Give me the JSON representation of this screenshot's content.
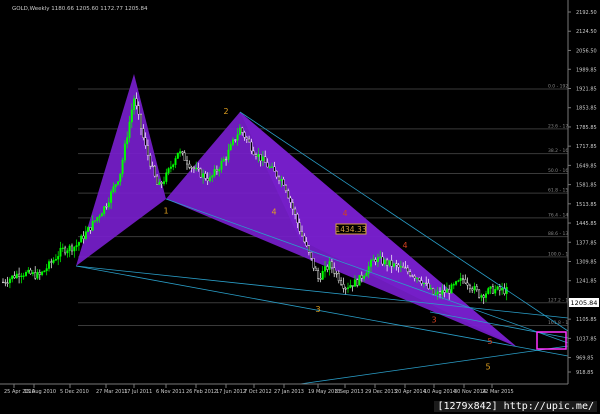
{
  "header": {
    "symbol_text": "GOLD,Weekly  1180.66 1205.60 1172.77 1205.84"
  },
  "chart_data": {
    "type": "candlestick",
    "instrument": "GOLD",
    "timeframe": "Weekly",
    "ohlc": [
      1180.66,
      1205.6,
      1172.77,
      1205.84
    ],
    "ylim": [
      916.0,
      2205.0
    ],
    "y_ticks": [
      "2192.50",
      "2124.50",
      "2056.50",
      "1989.85",
      "1921.85",
      "1853.85",
      "1785.85",
      "1717.85",
      "1649.85",
      "1581.85",
      "1513.85",
      "1445.85",
      "1377.85",
      "1309.85",
      "1241.85",
      "1173.85",
      "1105.85",
      "1037.85",
      "969.85",
      "918.85"
    ],
    "x_ticks": [
      "25 Apr 2010",
      "15 Aug 2010",
      "5 Dec 2010",
      "27 Mar 2011",
      "17 Jul 2011",
      "6 Nov 2011",
      "26 Feb 2012",
      "17 Jun 2012",
      "7 Oct 2012",
      "27 Jan 2013",
      "19 May 2013",
      "8 Sep 2013",
      "29 Dec 2013",
      "20 Apr 2014",
      "10 Aug 2014",
      "30 Nov 2014",
      "22 Mar 2015"
    ],
    "price_box": "1434.33",
    "current_price_tag": "1205.84",
    "fib_labels": [
      "0.0 - 1920.00",
      "23.6 - 1779.10",
      "38.2 - 1691.48",
      "50.0 - 1621.24",
      "61.8 - 1551.57",
      "76.4 - 1463.94",
      "88.6 - 1397.89",
      "100.0 - 1326.37",
      "127.2 - 1163.66",
      "161.8 - 1083.31"
    ],
    "pattern_points": [
      {
        "label": "2",
        "x": "17 Jun 2012",
        "y": 1790.0
      },
      {
        "label": "1",
        "x": "6 Nov 2011",
        "y": 1530.0
      },
      {
        "label": "4",
        "x": "27 Jan 2013",
        "y": 1440.0
      },
      {
        "label": "4",
        "x": "8 Sep 2013",
        "y": 1435.0
      },
      {
        "label": "4",
        "x": "20 Apr 2014",
        "y": 1330.0
      },
      {
        "label": "3",
        "x": "19 May 2013",
        "y": 1180.0
      },
      {
        "label": "3",
        "x": "10 Aug 2014",
        "y": 1130.0
      },
      {
        "label": "5",
        "x": "22 Mar 2015",
        "y": 1060.0
      },
      {
        "label": "5",
        "x": "22 Mar 2015",
        "y": 1020.0
      }
    ],
    "colors": {
      "background": "#000000",
      "bull": "#00ff00",
      "bear": "#ffffff",
      "pattern_fill": "#7a1fd0",
      "trendline": "#2a9fc9",
      "label": "#e0a020",
      "target_box": "#ff33ff"
    }
  },
  "watermark": "[1279x842]  http://upic.me/"
}
